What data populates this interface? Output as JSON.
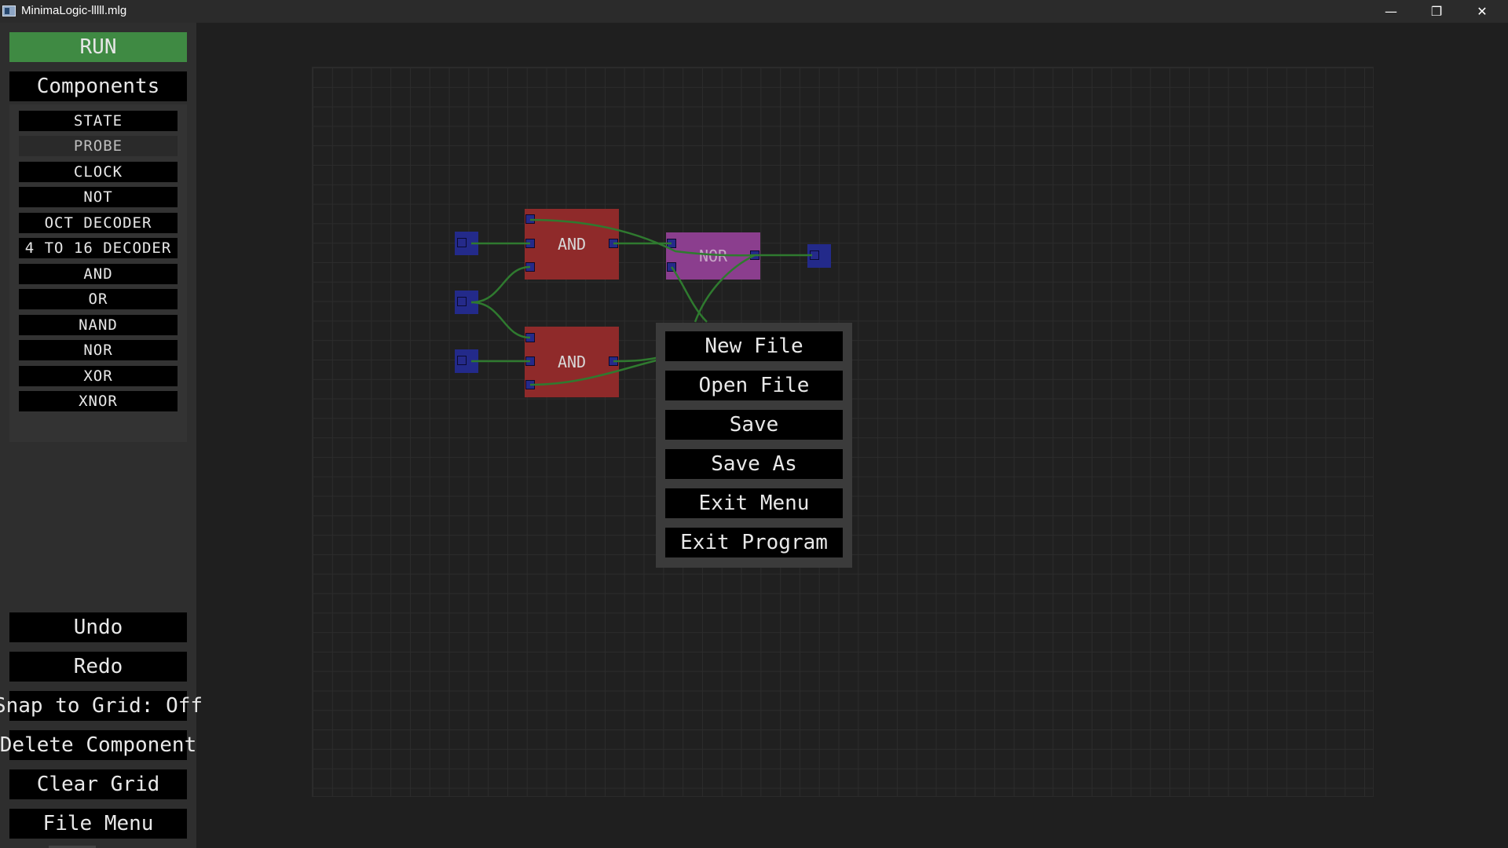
{
  "window": {
    "title": "MinimaLogic-lllll.mlg",
    "minimize_glyph": "—",
    "maximize_glyph": "❐",
    "close_glyph": "✕"
  },
  "sidebar": {
    "run_label": "RUN",
    "components_label": "Components",
    "components": [
      "STATE",
      "PROBE",
      "CLOCK",
      "NOT",
      "OCT DECODER",
      "4 TO 16 DECODER",
      "AND",
      "OR",
      "NAND",
      "NOR",
      "XOR",
      "XNOR"
    ],
    "highlighted_component": "PROBE",
    "actions": {
      "undo": "Undo",
      "redo": "Redo",
      "snap": "Snap to Grid: Off",
      "delete": "Delete Component",
      "clear": "Clear Grid",
      "file_menu": "File Menu"
    }
  },
  "canvas": {
    "gates": {
      "and_top": "AND",
      "nor": "NOR",
      "and_bottom": "AND"
    }
  },
  "file_menu": {
    "new_file": "New File",
    "open_file": "Open File",
    "save": "Save",
    "save_as": "Save As",
    "exit_menu": "Exit Menu",
    "exit_program": "Exit Program"
  },
  "colors": {
    "run": "#3f8a43",
    "and_gate": "#8f2a2a",
    "nor_gate": "#8b3e8e",
    "pin": "#252a8a",
    "wire": "#2f7a2f"
  }
}
